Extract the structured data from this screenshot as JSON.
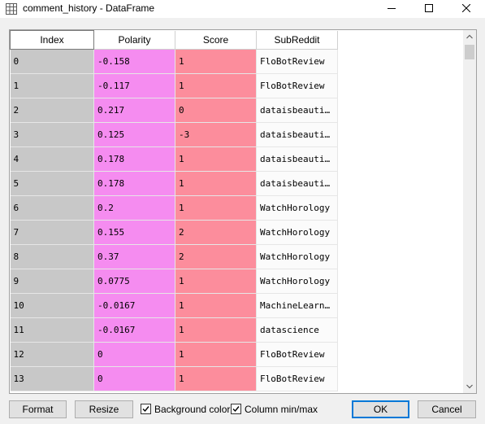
{
  "window": {
    "title": "comment_history - DataFrame",
    "icon": "table-icon",
    "controls": [
      "minimize-icon",
      "maximize-icon",
      "close-icon"
    ]
  },
  "table": {
    "columns": [
      "Index",
      "Polarity",
      "Score",
      "SubReddit"
    ],
    "rows": [
      [
        "0",
        "-0.158",
        "1",
        "FloBotReview"
      ],
      [
        "1",
        "-0.117",
        "1",
        "FloBotReview"
      ],
      [
        "2",
        "0.217",
        "0",
        "dataisbeauti…"
      ],
      [
        "3",
        "0.125",
        "-3",
        "dataisbeauti…"
      ],
      [
        "4",
        "0.178",
        "1",
        "dataisbeauti…"
      ],
      [
        "5",
        "0.178",
        "1",
        "dataisbeauti…"
      ],
      [
        "6",
        "0.2",
        "1",
        "WatchHorology"
      ],
      [
        "7",
        "0.155",
        "2",
        "WatchHorology"
      ],
      [
        "8",
        "0.37",
        "2",
        "WatchHorology"
      ],
      [
        "9",
        "0.0775",
        "1",
        "WatchHorology"
      ],
      [
        "10",
        "-0.0167",
        "1",
        "MachineLearn…"
      ],
      [
        "11",
        "-0.0167",
        "1",
        "datascience"
      ],
      [
        "12",
        "0",
        "1",
        "FloBotReview"
      ],
      [
        "13",
        "0",
        "1",
        "FloBotReview"
      ]
    ],
    "colors": {
      "index_bg": "#c8c8c8",
      "polarity_bg": "#f58cf0",
      "score_bg": "#fc8d9c",
      "subreddit_bg": "#fbfbfb"
    }
  },
  "buttons": {
    "format": "Format",
    "resize": "Resize",
    "ok": "OK",
    "cancel": "Cancel"
  },
  "checkboxes": {
    "background_color": {
      "label": "Background color",
      "checked": true
    },
    "column_minmax": {
      "label": "Column min/max",
      "checked": true
    }
  }
}
